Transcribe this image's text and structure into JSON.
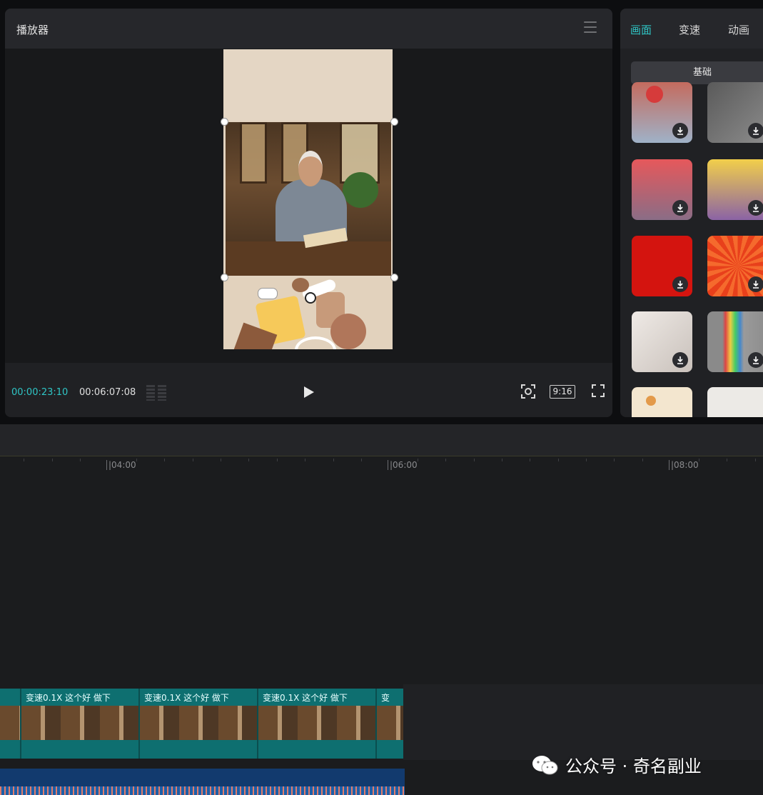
{
  "player": {
    "title": "播放器",
    "time_current": "00:00:23:10",
    "time_total": "00:06:07:08",
    "ratio_label": "9:16"
  },
  "right_panel": {
    "tabs": [
      {
        "label": "画面",
        "active": true
      },
      {
        "label": "变速",
        "active": false
      },
      {
        "label": "动画",
        "active": false
      }
    ],
    "subtab": "基础",
    "backgrounds": [
      {
        "name": "flower-pattern"
      },
      {
        "name": "gray-texture"
      },
      {
        "name": "pink-gradient"
      },
      {
        "name": "yellow-gradient"
      },
      {
        "name": "red-glitter"
      },
      {
        "name": "orange-sunburst"
      },
      {
        "name": "leaf-shadow"
      },
      {
        "name": "rainbow-light"
      },
      {
        "name": "floral-cream"
      },
      {
        "name": "white-leaves"
      }
    ]
  },
  "timeline": {
    "ruler_labels": [
      "|04:00",
      "|06:00",
      "|08:00"
    ],
    "clips": [
      {
        "label": "变速0.1X  这个好 做下"
      },
      {
        "label": "变速0.1X  这个好 做下"
      },
      {
        "label": "变速0.1X  这个好 做下"
      },
      {
        "label": "变"
      }
    ]
  },
  "watermark": "公众号 · 奇名副业",
  "colors": {
    "accent": "#2fc6c6",
    "clip": "#0e6f70",
    "audio": "#123a6e"
  }
}
